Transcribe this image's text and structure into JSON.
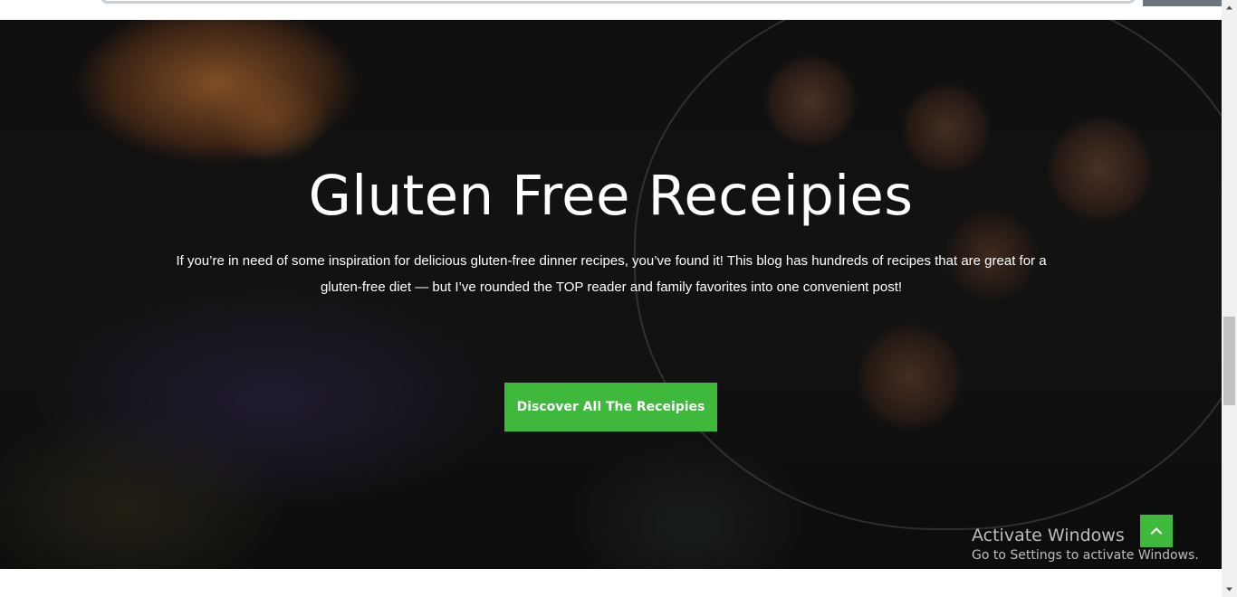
{
  "hero": {
    "title": "Gluten Free Receipies",
    "description": "If you’re in need of some inspiration for delicious gluten-free dinner recipes, you’ve found it! This blog has hundreds of recipes that are great for a gluten-free diet — but I’ve rounded the TOP reader and family favorites into one convenient post!",
    "cta_label": "Discover All The Receipies",
    "background_icon": "food-photo"
  },
  "back_to_top": {
    "icon": "chevron-up-icon"
  },
  "watermark": {
    "title": "Activate Windows",
    "subtitle": "Go to Settings to activate Windows."
  },
  "colors": {
    "accent": "#3fb93c",
    "hero_text": "#ffffff",
    "scrollbar_thumb": "#c1c1c1"
  }
}
